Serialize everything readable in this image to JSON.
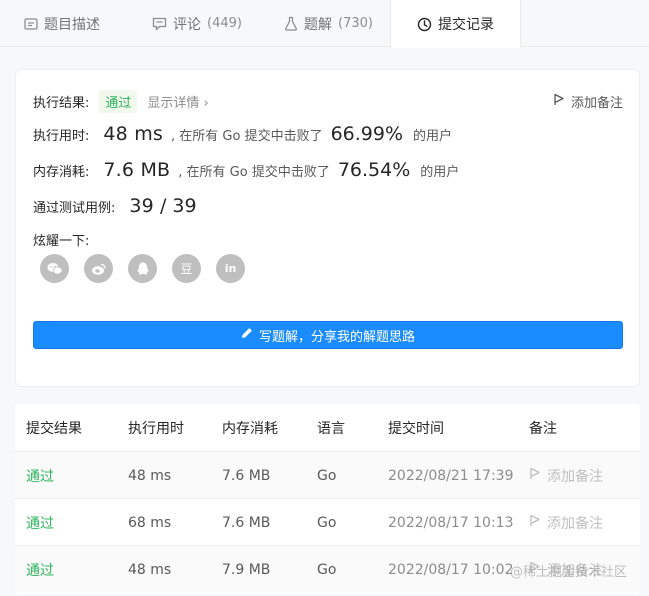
{
  "tabs": [
    {
      "label": "题目描述",
      "icon": "document-icon"
    },
    {
      "label": "评论",
      "count": "(449)",
      "icon": "comment-icon"
    },
    {
      "label": "题解",
      "count": "(730)",
      "icon": "flask-icon"
    },
    {
      "label": "提交记录",
      "icon": "clock-icon",
      "active": true
    }
  ],
  "result": {
    "status_label": "执行结果:",
    "status_value": "通过",
    "detail_link": "显示详情 ›",
    "add_note": "添加备注",
    "runtime_label": "执行用时:",
    "runtime_value": "48 ms",
    "runtime_mid": ", 在所有 Go 提交中击败了",
    "runtime_pct": "66.99%",
    "runtime_tail": "的用户",
    "memory_label": "内存消耗:",
    "memory_value": "7.6 MB",
    "memory_mid": ", 在所有 Go 提交中击败了",
    "memory_pct": "76.54%",
    "memory_tail": "的用户",
    "tests_label": "通过测试用例:",
    "tests_passed": "39",
    "tests_sep": "/",
    "tests_total": "39",
    "share_label": "炫耀一下:",
    "share_icons": [
      "wechat-icon",
      "weibo-icon",
      "qq-icon",
      "douban-icon",
      "linkedin-icon"
    ],
    "share_glyphs": {
      "douban": "豆",
      "linkedin": "in"
    },
    "write_button": "写题解，分享我的解题思路"
  },
  "table": {
    "headers": [
      "提交结果",
      "执行用时",
      "内存消耗",
      "语言",
      "提交时间",
      "备注"
    ],
    "rows": [
      {
        "status": "通过",
        "runtime": "48 ms",
        "memory": "7.6 MB",
        "lang": "Go",
        "time": "2022/08/21 17:39",
        "note": "添加备注"
      },
      {
        "status": "通过",
        "runtime": "68 ms",
        "memory": "7.6 MB",
        "lang": "Go",
        "time": "2022/08/17 10:13",
        "note": "添加备注"
      },
      {
        "status": "通过",
        "runtime": "48 ms",
        "memory": "7.9 MB",
        "lang": "Go",
        "time": "2022/08/17 10:02",
        "note": "添加备注"
      }
    ]
  },
  "watermark": "@稀土掘金技术社区",
  "colors": {
    "accent": "#1a8cff",
    "success": "#2db55d"
  }
}
